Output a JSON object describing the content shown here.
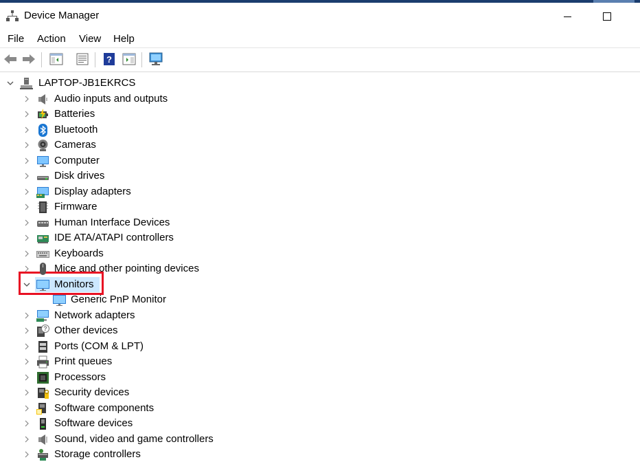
{
  "window": {
    "title": "Device Manager"
  },
  "menu": [
    "File",
    "Action",
    "View",
    "Help"
  ],
  "toolbar": [
    "back-icon",
    "forward-icon",
    "show-hide-console-tree-icon",
    "properties-icon",
    "help-icon",
    "action-pane-icon",
    "scan-hardware-icon"
  ],
  "colors": {
    "selection": "#cce8ff",
    "highlight_border": "#e81123"
  },
  "tree": {
    "root": {
      "label": "LAPTOP-JB1EKRCS",
      "icon": "computer-tower-icon",
      "expanded": true
    },
    "items": [
      {
        "label": "Audio inputs and outputs",
        "icon": "speaker-icon"
      },
      {
        "label": "Batteries",
        "icon": "battery-icon"
      },
      {
        "label": "Bluetooth",
        "icon": "bluetooth-icon"
      },
      {
        "label": "Cameras",
        "icon": "camera-icon"
      },
      {
        "label": "Computer",
        "icon": "computer-icon"
      },
      {
        "label": "Disk drives",
        "icon": "disk-drive-icon"
      },
      {
        "label": "Display adapters",
        "icon": "display-adapter-icon"
      },
      {
        "label": "Firmware",
        "icon": "firmware-icon"
      },
      {
        "label": "Human Interface Devices",
        "icon": "hid-icon"
      },
      {
        "label": "IDE ATA/ATAPI controllers",
        "icon": "ide-controller-icon"
      },
      {
        "label": "Keyboards",
        "icon": "keyboard-icon"
      },
      {
        "label": "Mice and other pointing devices",
        "icon": "mouse-icon"
      },
      {
        "label": "Monitors",
        "icon": "monitor-icon",
        "expanded": true,
        "selected": true,
        "children": [
          {
            "label": "Generic PnP Monitor",
            "icon": "monitor-icon"
          }
        ]
      },
      {
        "label": "Network adapters",
        "icon": "network-adapter-icon"
      },
      {
        "label": "Other devices",
        "icon": "other-devices-icon"
      },
      {
        "label": "Ports (COM & LPT)",
        "icon": "port-icon"
      },
      {
        "label": "Print queues",
        "icon": "printer-icon"
      },
      {
        "label": "Processors",
        "icon": "processor-icon"
      },
      {
        "label": "Security devices",
        "icon": "security-device-icon"
      },
      {
        "label": "Software components",
        "icon": "software-component-icon"
      },
      {
        "label": "Software devices",
        "icon": "software-device-icon"
      },
      {
        "label": "Sound, video and game controllers",
        "icon": "sound-controller-icon"
      },
      {
        "label": "Storage controllers",
        "icon": "storage-controller-icon"
      }
    ]
  }
}
